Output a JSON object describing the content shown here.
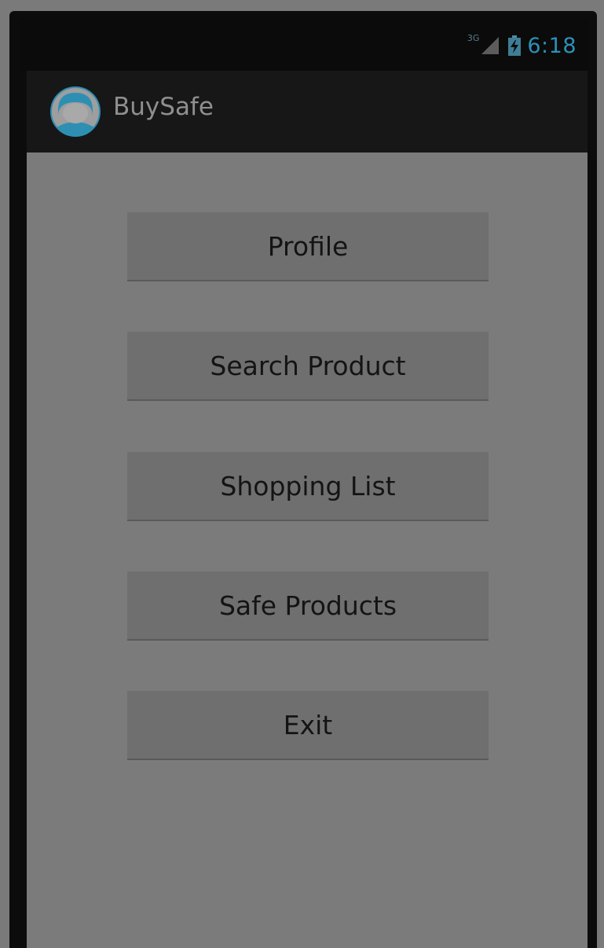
{
  "status_bar": {
    "network": "3G",
    "time": "6:18",
    "icons": [
      "signal-icon",
      "battery-charging-icon"
    ]
  },
  "action_bar": {
    "app_icon": "buysafe-logo-icon",
    "title": "BuySafe"
  },
  "menu": {
    "buttons": [
      {
        "label": "Profile"
      },
      {
        "label": "Search Product"
      },
      {
        "label": "Shopping List"
      },
      {
        "label": "Safe Products"
      },
      {
        "label": "Exit"
      }
    ]
  },
  "colors": {
    "clock": "#2d90b8",
    "logo": "#2e8fb3",
    "button_bg": "#6f6f6f",
    "content_bg": "#7b7b7b"
  }
}
